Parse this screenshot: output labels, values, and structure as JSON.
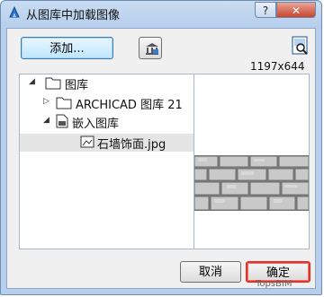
{
  "window": {
    "title": "从图库中加载图像"
  },
  "titlebar": {
    "help_label": "?",
    "close_label": "✕"
  },
  "toolbar": {
    "add_label": "添加...",
    "library_icon": "library-icon",
    "preview_icon": "zoom-preview-icon"
  },
  "image_size": "1197x644",
  "tree": {
    "items": [
      {
        "label": "图库",
        "icon": "folder-icon",
        "arrow": "◢",
        "level": 0
      },
      {
        "label": "ARCHICAD 图库 21",
        "icon": "folder-icon",
        "arrow": "▷",
        "level": 1
      },
      {
        "label": "嵌入图库",
        "icon": "embedded-file-icon",
        "arrow": "◢",
        "level": 1
      },
      {
        "label": "石墙饰面.jpg",
        "icon": "image-file-icon",
        "arrow": "",
        "level": 2,
        "selected": true
      }
    ]
  },
  "footer": {
    "cancel_label": "取消",
    "ok_label": "确定"
  },
  "watermark": "TopsBIM"
}
